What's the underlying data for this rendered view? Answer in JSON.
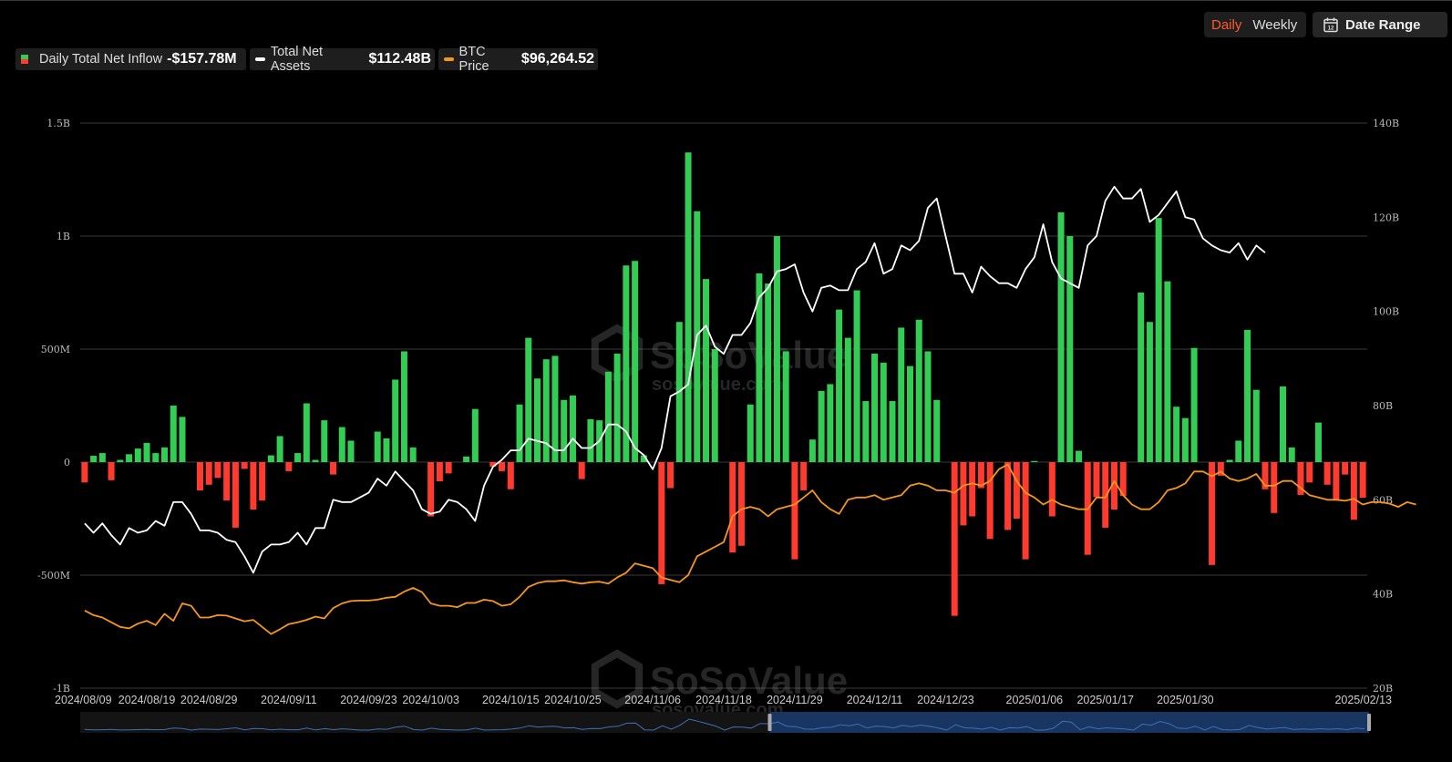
{
  "controls": {
    "daily": "Daily",
    "weekly": "Weekly",
    "date_range": "Date Range"
  },
  "legend": {
    "inflow": {
      "label": "Daily Total Net Inflow",
      "value": "-$157.78M"
    },
    "assets": {
      "label": "Total Net Assets",
      "value": "$112.48B"
    },
    "price": {
      "label": "BTC Price",
      "value": "$96,264.52"
    }
  },
  "colors": {
    "positive": "#32cd52",
    "negative": "#ff3b30",
    "assets": "#ffffff",
    "price": "#f5961e",
    "grid": "#3a3a3a",
    "brush_fill": "#1a3a6a"
  },
  "watermark": {
    "brand": "SoSoValue",
    "url": "sosovalue.com"
  },
  "chart_data": {
    "type": "bar",
    "left_axis": {
      "ticks": [
        "1.5B",
        "1B",
        "500M",
        "0",
        "-500M",
        "-1B"
      ],
      "range": [
        -1000,
        1500
      ],
      "unit": "M"
    },
    "right_axis": {
      "ticks": [
        "140B",
        "120B",
        "100B",
        "80B",
        "60B",
        "40B",
        "20B"
      ],
      "range": [
        20,
        140
      ],
      "unit": "B"
    },
    "x_tick_labels": [
      "2024/08/09",
      "2024/08/19",
      "2024/08/29",
      "2024/09/11",
      "2024/09/23",
      "2024/10/03",
      "2024/10/15",
      "2024/10/25",
      "2024/11/06",
      "2024/11/18",
      "2024/11/29",
      "2024/12/11",
      "2024/12/23",
      "2025/01/06",
      "2025/01/17",
      "2025/01/30",
      "2025/02/13"
    ],
    "x_tick_positions": [
      0,
      7,
      14,
      23,
      32,
      39,
      48,
      55,
      64,
      72,
      80,
      89,
      97,
      107,
      115,
      124,
      134
    ],
    "grid": true,
    "series": [
      {
        "name": "Daily Total Net Inflow",
        "type": "bar",
        "unit": "M",
        "values": [
          -90,
          28,
          40,
          -80,
          10,
          35,
          60,
          85,
          40,
          65,
          250,
          200,
          0,
          -125,
          -100,
          -70,
          -170,
          -290,
          -30,
          -210,
          -170,
          30,
          115,
          -40,
          40,
          260,
          10,
          185,
          -55,
          155,
          95,
          0,
          0,
          135,
          105,
          365,
          490,
          65,
          0,
          -240,
          -85,
          -50,
          0,
          25,
          235,
          0,
          -20,
          -40,
          -120,
          255,
          550,
          370,
          455,
          470,
          275,
          295,
          -75,
          190,
          185,
          400,
          480,
          870,
          890,
          30,
          0,
          -540,
          -115,
          620,
          1370,
          1110,
          810,
          500,
          0,
          -400,
          -370,
          255,
          835,
          790,
          1000,
          490,
          -430,
          -125,
          100,
          315,
          345,
          675,
          550,
          760,
          270,
          480,
          440,
          270,
          595,
          425,
          630,
          490,
          275,
          0,
          -680,
          -280,
          -240,
          -115,
          -340,
          0,
          -300,
          -250,
          -430,
          5,
          0,
          -240,
          1105,
          1000,
          50,
          -410,
          -155,
          -290,
          -210,
          -150,
          0,
          750,
          620,
          1080,
          800,
          245,
          195,
          505,
          0,
          -455,
          -60,
          10,
          95,
          585,
          320,
          -120,
          -225,
          335,
          65,
          -145,
          -90,
          175,
          -100,
          -170,
          -55,
          -255,
          -157.78
        ]
      },
      {
        "name": "Total Net Assets",
        "type": "line",
        "unit": "B",
        "values": [
          55,
          53,
          55,
          52.5,
          50.5,
          54,
          53,
          53.5,
          55.5,
          54.5,
          59.5,
          59.5,
          57,
          53.5,
          53.5,
          53,
          51.5,
          51,
          48,
          44.5,
          49,
          50.5,
          50.5,
          51,
          53,
          50.5,
          54,
          54,
          60,
          59.5,
          59.5,
          60.5,
          61.5,
          64.5,
          63,
          66,
          64,
          62,
          58,
          57,
          57.5,
          60,
          59.5,
          58,
          55.5,
          63,
          67,
          68.5,
          70.5,
          70.5,
          73,
          72.5,
          72,
          70.5,
          70.5,
          73,
          71,
          71,
          72.5,
          76,
          76,
          74.5,
          71,
          69.5,
          66.5,
          71,
          82,
          83,
          84.5,
          95,
          97,
          92.5,
          91,
          95,
          95,
          97.5,
          103,
          105,
          108.5,
          109,
          110,
          104,
          100,
          105,
          105.5,
          104.5,
          104.5,
          109,
          110.5,
          114.5,
          108,
          109,
          114,
          113,
          115,
          122,
          124,
          116,
          108,
          108,
          104,
          109.5,
          107.5,
          106,
          106,
          105,
          109,
          111.5,
          118.5,
          110.5,
          107,
          106,
          105,
          114,
          116,
          123.5,
          126.5,
          124,
          124,
          126,
          119,
          120.5,
          123,
          125.5,
          120,
          119.5,
          115.5,
          114,
          113,
          112.5,
          114.5,
          111,
          114,
          112.48
        ]
      },
      {
        "name": "BTC Price",
        "type": "line",
        "unit": "B",
        "values": [
          36.5,
          35.5,
          35,
          34,
          33,
          32.7,
          33.7,
          34.3,
          33.4,
          35.8,
          34.3,
          38,
          37.5,
          35,
          35,
          35.5,
          35.4,
          34.8,
          34.2,
          34.5,
          33,
          31.5,
          32.5,
          33.6,
          34,
          34.5,
          35.2,
          34.8,
          37,
          38,
          38.5,
          38.6,
          38.6,
          38.8,
          39.2,
          39.4,
          40.5,
          41.3,
          40.4,
          38,
          37.5,
          37.5,
          37.2,
          38.1,
          38.1,
          38.8,
          38.5,
          37.5,
          37.8,
          39.4,
          41.5,
          42.3,
          42.7,
          42.7,
          42.9,
          42.5,
          42.2,
          42.5,
          42.6,
          42.2,
          43.5,
          44.5,
          46.5,
          46,
          45.5,
          43.5,
          43,
          42.5,
          44,
          48,
          49,
          50,
          51,
          56.5,
          58,
          58.5,
          58,
          56.5,
          58,
          58.5,
          59,
          60.5,
          62,
          59.5,
          58,
          57,
          60,
          60.5,
          60.5,
          61,
          60,
          60.5,
          61,
          63,
          63.5,
          63,
          62,
          62,
          61.5,
          63,
          63.5,
          63,
          64,
          66.5,
          67.5,
          64,
          61.5,
          60.5,
          59,
          60,
          59,
          58.5,
          58,
          58,
          60.5,
          60.5,
          64,
          61,
          59,
          58,
          58,
          59.5,
          62,
          62.5,
          63.5,
          66,
          66,
          65,
          66,
          64.5,
          64,
          64.5,
          65.5,
          63,
          63,
          64,
          64,
          62.5,
          61,
          60.5,
          60,
          60,
          59.8,
          60.2,
          59,
          59.5,
          59.5,
          59.2,
          58.5,
          59.5,
          59
        ]
      }
    ]
  }
}
